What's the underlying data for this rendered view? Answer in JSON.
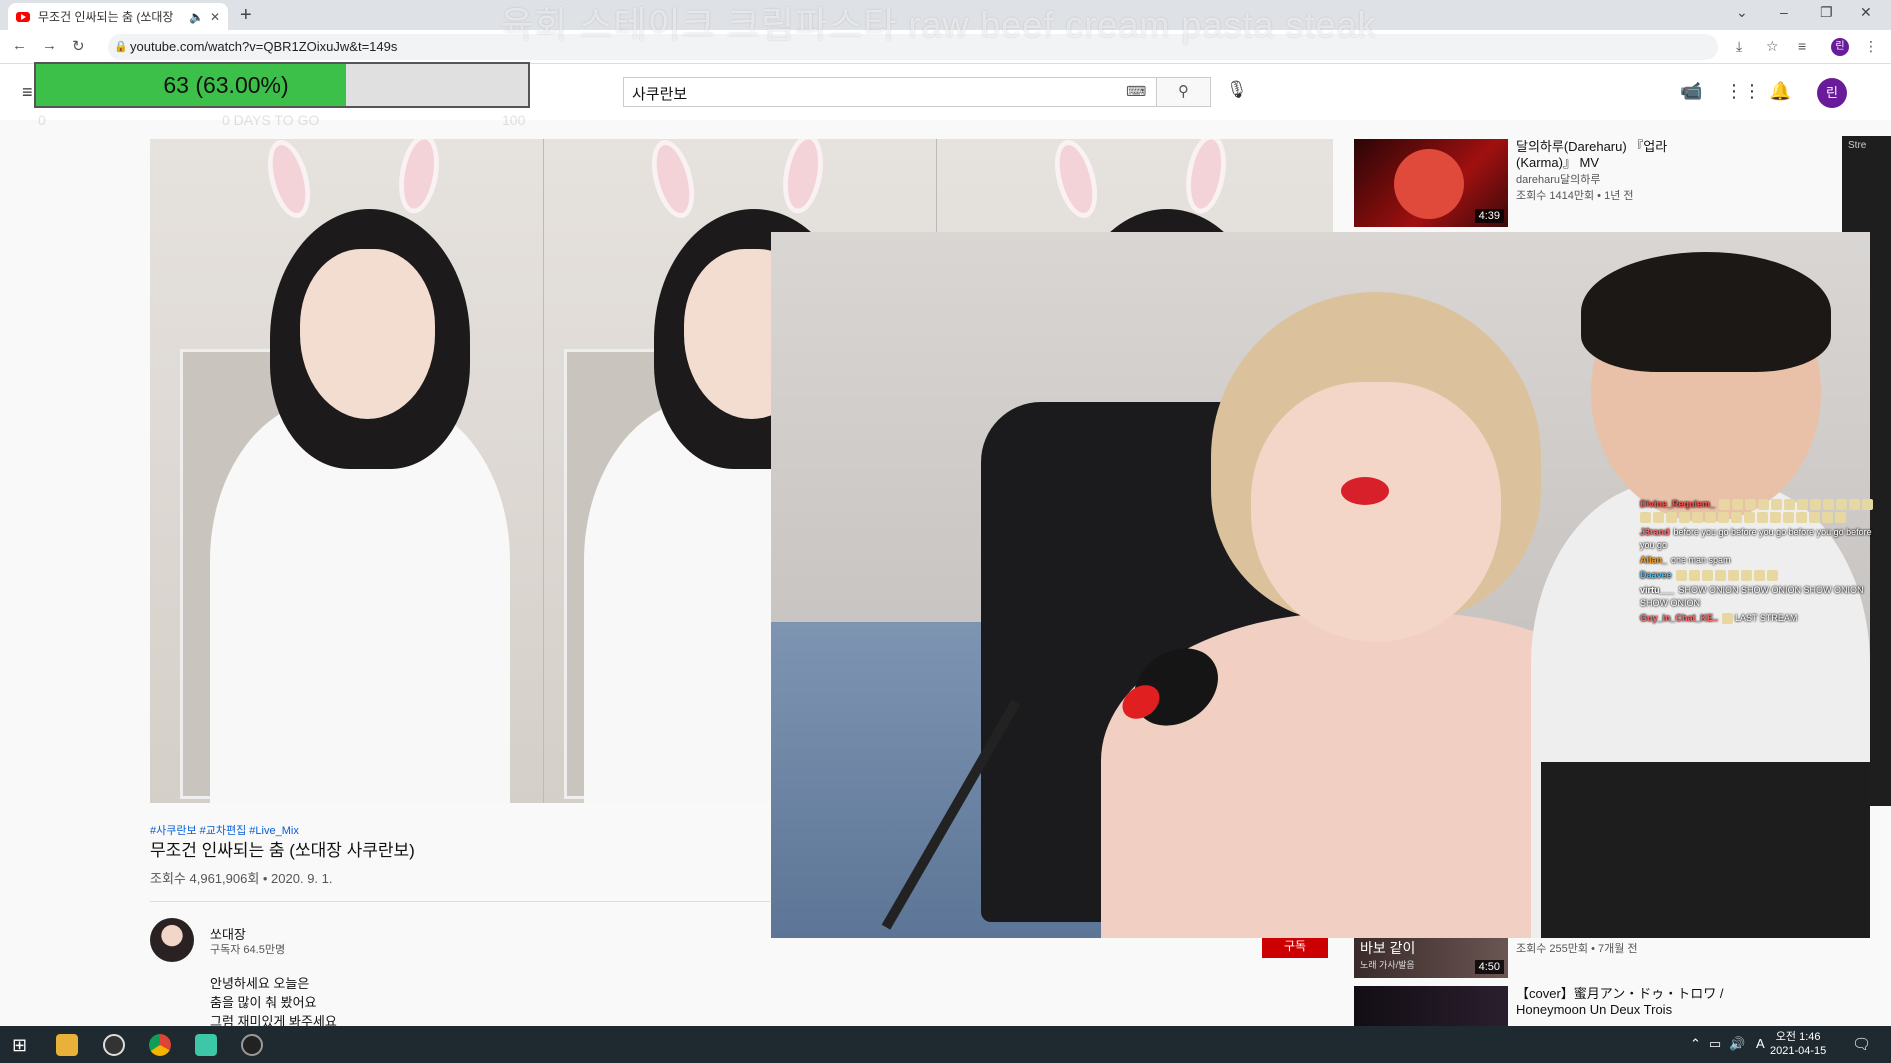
{
  "browser": {
    "tab_title": "무조건 인싸되는 춤 (쏘대장",
    "url": "youtube.com/watch?v=QBR1ZOixuJw&t=149s"
  },
  "overlay": {
    "stream_title": "육회 스테이크 크림파스타 raw beef cream pasta steak",
    "progress_text": "63 (63.00%)",
    "progress_fraction": 0.63,
    "progress_min": "0",
    "progress_max": "100",
    "progress_caption": "0 DAYS TO GO"
  },
  "youtube": {
    "search_query": "사쿠란보"
  },
  "video": {
    "tags": "#사쿠란보 #교차편집 #Live_Mix",
    "title": "무조건 인싸되는 춤 (쏘대장 사쿠란보)",
    "meta": "조회수 4,961,906회 • 2020. 9. 1.",
    "channel": "쏘대장",
    "subscribers": "구독자 64.5만명",
    "subscribe_label": "구독",
    "description": [
      "안녕하세요 오늘은",
      "춤을 많이 춰 봤어요",
      "그럼 재미있게 봐주세요"
    ]
  },
  "related": [
    {
      "title": "달의하루(Dareharu) 『업라(Karma)』 MV",
      "channel": "dareharu달의하루",
      "meta": "조회수 1414만회 • 1년 전",
      "duration": "4:39"
    },
    {
      "title": "",
      "channel": "",
      "meta": "조회수 255만회 • 7개월 전",
      "duration": "4:50",
      "thumb_text": "바보 같이",
      "thumb_subtext": "노래 가사/발음"
    },
    {
      "title": "【cover】蜜月アン・ドゥ・トロワ / Honeymoon Un Deux Trois",
      "channel": "",
      "meta": "",
      "duration": ""
    }
  ],
  "stream_panel_label": "Stre",
  "chat": [
    {
      "user": "Divine_Requiem_",
      "text": "",
      "color": "#ff4d4d"
    },
    {
      "user": "J3rand",
      "text": "before you go before you go before you go before you go",
      "color": "#ff6b6b"
    },
    {
      "user": "Allan_",
      "text": "one man spam",
      "color": "#ff9f1a"
    },
    {
      "user": "Daavee",
      "text": "",
      "color": "#4fc3f7"
    },
    {
      "user": "virtu___",
      "text": "SHOW ONION SHOW ONION SHOW ONION SHOW ONION",
      "color": "#ffffff"
    },
    {
      "user": "Guy_in_Chat_KE..",
      "text": "LAST STREAM",
      "color": "#ff6b6b"
    }
  ],
  "taskbar": {
    "time": "오전 1:46",
    "date": "2021-04-15",
    "ime": "A"
  }
}
